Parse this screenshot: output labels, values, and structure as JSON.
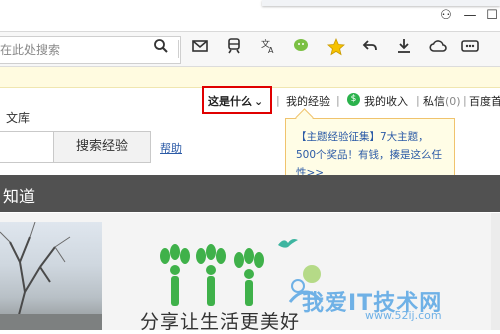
{
  "window": {
    "controls": [
      "user-icon",
      "minimize-icon",
      "maximize-icon"
    ],
    "minimize_symbol": "—",
    "maximize_symbol": "☐",
    "user_symbol": "⚇"
  },
  "toolbar": {
    "search_placeholder": "在此处搜索",
    "icons": [
      "search-icon",
      "mail-icon",
      "train-icon",
      "translate-icon",
      "wechat-icon",
      "star-icon",
      "back-arrow-icon",
      "download-icon",
      "cloud-icon",
      "more-icon"
    ]
  },
  "nav": {
    "what_is_this": "这是什么",
    "what_arrow": "⌄",
    "sep": "|",
    "my_experience": "我的经验",
    "money_symbol": "$",
    "my_income": "我的收入",
    "private_msg": "私信",
    "msg_count": "(0)",
    "baidu_home": "百度首",
    "wenku": "文库"
  },
  "search": {
    "button_label": "搜索经验",
    "help_label": "帮助"
  },
  "tooltip": {
    "highlight": "【主题经验征集】",
    "text": "7大主题，500个奖品！有钱，揍是这么任性>>"
  },
  "banner": {
    "title": "知道"
  },
  "content": {
    "slogan": "分享让生活更美好",
    "watermark": "我爱IT技术网",
    "watermark_url": "www.52ij.com",
    "watermark_sub": "我爱IT技术网"
  },
  "colors": {
    "accent_red": "#e00000",
    "link_blue": "#2b5aa6",
    "money_green": "#2bb24c",
    "banner_dark": "#515151",
    "tooltip_bg": "#fffde6",
    "tree_green": "#3fb14a",
    "bird_teal": "#3db5a0"
  }
}
